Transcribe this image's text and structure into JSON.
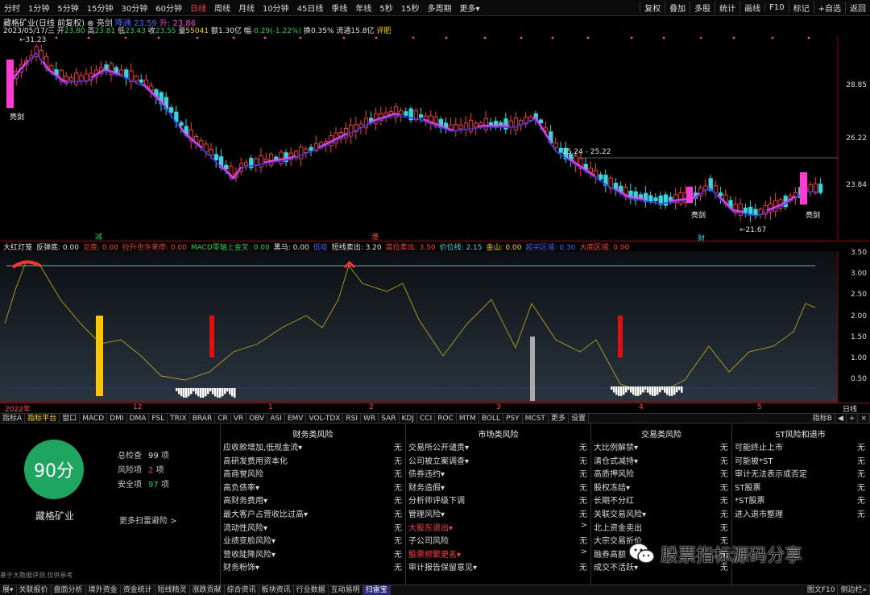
{
  "toolbar": {
    "periods": [
      "分时",
      "1分钟",
      "5分钟",
      "15分钟",
      "30分钟",
      "60分钟",
      "日线",
      "周线",
      "月线",
      "10分钟",
      "45日线",
      "季线",
      "年线",
      "5秒",
      "15秒",
      "多周期",
      "更多▾"
    ],
    "active_period": "日线",
    "right": [
      "复权",
      "叠加",
      "多股",
      "统计",
      "画线",
      "F10",
      "标记",
      "+自选",
      "返回"
    ]
  },
  "stock": {
    "name": "藏格矿业",
    "mode": "(日线 前复权)",
    "indicator": "亮剑",
    "date": "2023/05/17/三",
    "open_label": "开",
    "open": "23.80",
    "high_label": "高",
    "high": "23.81",
    "low_label": "低",
    "low": "23.43",
    "close_label": "收",
    "close": "23.55",
    "vol_label": "量",
    "vol": "55041",
    "amt_label": "额",
    "amt": "1.30亿",
    "chg_label": "幅",
    "chg": "-0.29(-1.22%)",
    "turn_label": "换",
    "turn": "0.35%",
    "float_label": "流通",
    "float": "15.8亿",
    "extra": "评肥"
  },
  "price_axis": [
    "28.85",
    "26.22",
    "23.84"
  ],
  "price_annotations": {
    "high": "31.23",
    "mid_range": "25.24 - 25.22",
    "low": "21.67"
  },
  "markers": {
    "cb_left": "减",
    "cb_mid": "港",
    "lj_sword": "亮剑",
    "cai": "财"
  },
  "indicator_header": [
    {
      "label": "大红灯笼",
      "cls": "w"
    },
    {
      "label": "反弹底: 0.00",
      "cls": "w"
    },
    {
      "label": "见底: 0.00",
      "cls": "r"
    },
    {
      "label": "拉升也许来停: 0.00",
      "cls": "r"
    },
    {
      "label": "MACD零轴上金叉: 0.00",
      "cls": "g"
    },
    {
      "label": "黑马: 0.00",
      "cls": "w"
    },
    {
      "label": "低吸",
      "cls": "b"
    },
    {
      "label": "短线卖出: 3.20",
      "cls": "w"
    },
    {
      "label": "高位卖出: 3.50",
      "cls": "r"
    },
    {
      "label": "价位线: 2.15",
      "cls": "c"
    },
    {
      "label": "金山: 0.00",
      "cls": "y"
    },
    {
      "label": "超买区域: 0.30",
      "cls": "b"
    },
    {
      "label": "大底区域: 0.00",
      "cls": "r"
    }
  ],
  "indicator_axis": [
    "3.50",
    "3.00",
    "2.50",
    "2.00",
    "1.50",
    "1.00",
    "0.50"
  ],
  "time_axis": [
    "2022年",
    "12",
    "1",
    "2",
    "3",
    "4",
    "5"
  ],
  "time_axis_right": "日线",
  "tabs": [
    "指标A",
    "指标平台",
    "窗口",
    "MACD",
    "DMI",
    "DMA",
    "FSL",
    "TRIX",
    "BRAR",
    "CR",
    "VR",
    "OBV",
    "ASI",
    "EMV",
    "VOL-TDX",
    "RSI",
    "WR",
    "SAR",
    "KDJ",
    "CCI",
    "ROC",
    "MTM",
    "BOLL",
    "PSY",
    "MCST",
    "更多",
    "设置"
  ],
  "active_tab": "指标平台",
  "tabs_right": [
    "指标B",
    "◀",
    "+",
    "×"
  ],
  "risk": {
    "score": "90分",
    "company": "藏格矿业",
    "summary": [
      {
        "label": "总检查",
        "value": "99",
        "unit": "项",
        "color": "#e6e6e6"
      },
      {
        "label": "风险项",
        "value": "2",
        "unit": "项",
        "color": "#ff3b3b"
      },
      {
        "label": "安全项",
        "value": "97",
        "unit": "项",
        "color": "#25d04a"
      }
    ],
    "more": "更多扫雷避险 >",
    "disclaimer": "基于大数据评测,仅供参考",
    "columns": [
      {
        "title": "财务类风险",
        "rows": [
          {
            "label": "应收款增加,低现金流▾",
            "status": "无"
          },
          {
            "label": "高研发费用资本化",
            "status": "无"
          },
          {
            "label": "高商誉风险",
            "status": "无"
          },
          {
            "label": "高负债率▾",
            "status": "无"
          },
          {
            "label": "高财务费用▾",
            "status": "无"
          },
          {
            "label": "最大客户占营收比过高▾",
            "status": "无"
          },
          {
            "label": "流动性风险▾",
            "status": "无"
          },
          {
            "label": "业绩变脸风险▾",
            "status": "无"
          },
          {
            "label": "营收陡降风险▾",
            "status": "无"
          },
          {
            "label": "财务粉饰▾",
            "status": "无"
          }
        ]
      },
      {
        "title": "市场类风险",
        "rows": [
          {
            "label": "交易所公开谴责▾",
            "status": "无"
          },
          {
            "label": "公司被立案调查▾",
            "status": "无"
          },
          {
            "label": "债券违约▾",
            "status": "无"
          },
          {
            "label": "财务造假▾",
            "status": "无"
          },
          {
            "label": "分析师评级下调",
            "status": "无"
          },
          {
            "label": "管理风险▾",
            "status": "无"
          },
          {
            "label": "大股东退出▾",
            "status": ">",
            "red": true
          },
          {
            "label": "子公司风险",
            "status": "无"
          },
          {
            "label": "股票频繁更名▾",
            "status": ">",
            "red": true
          },
          {
            "label": "审计报告保留意见▾",
            "status": "无"
          }
        ]
      },
      {
        "title": "交易类风险",
        "rows": [
          {
            "label": "大比例解禁▾",
            "status": "无"
          },
          {
            "label": "清仓式减持▾",
            "status": "无"
          },
          {
            "label": "高质押风险",
            "status": "无"
          },
          {
            "label": "股权冻结▾",
            "status": "无"
          },
          {
            "label": "长期不分红",
            "status": "无"
          },
          {
            "label": "关联交易风险▾",
            "status": "无"
          },
          {
            "label": "北上资金卖出",
            "status": "无"
          },
          {
            "label": "大宗交易折价",
            "status": "无"
          },
          {
            "label": "融券高额",
            "status": "无"
          },
          {
            "label": "成交不活跃▾",
            "status": "无"
          }
        ]
      },
      {
        "title": "ST风险和退市",
        "rows": [
          {
            "label": "可能终止上市",
            "status": "无"
          },
          {
            "label": "可能被*ST",
            "status": "无"
          },
          {
            "label": "审计无法表示或否定",
            "status": "无"
          },
          {
            "label": "ST股票",
            "status": "无"
          },
          {
            "label": "*ST股票",
            "status": "无"
          },
          {
            "label": "进入退市整理",
            "status": "无"
          }
        ]
      }
    ]
  },
  "statusbar": [
    "展▾",
    "关联报价",
    "盘面分析",
    "境外资金",
    "资金统计",
    "短线精灵",
    "涨跌贡献",
    "综合资讯",
    "板块资讯",
    "行业数据",
    "互动易明",
    "扫雷宝"
  ],
  "statusbar_active": "扫雷宝",
  "statusbar_right": [
    "图文F10",
    "侧边栏»"
  ],
  "watermark": "股票指标源码分享",
  "colors": {
    "up": "#ff3d3d",
    "down": "#33d6e0",
    "ma1": "#ff3bd3",
    "ma2": "#2f3bff",
    "score": "#1ea661"
  }
}
